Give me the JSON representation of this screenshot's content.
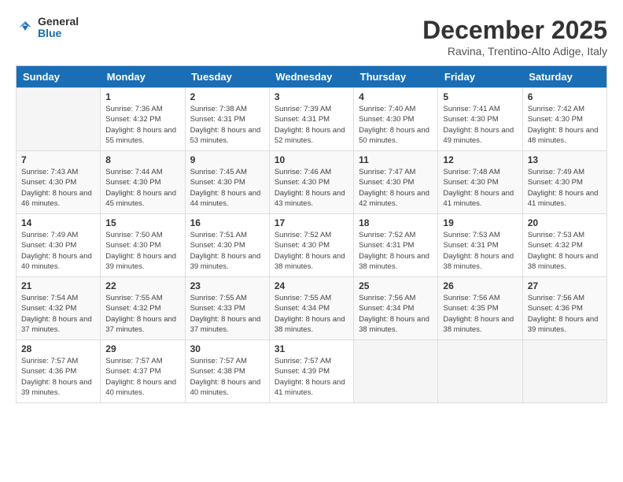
{
  "header": {
    "logo_line1": "General",
    "logo_line2": "Blue",
    "title": "December 2025",
    "subtitle": "Ravina, Trentino-Alto Adige, Italy"
  },
  "weekdays": [
    "Sunday",
    "Monday",
    "Tuesday",
    "Wednesday",
    "Thursday",
    "Friday",
    "Saturday"
  ],
  "weeks": [
    [
      {
        "day": "",
        "sunrise": "",
        "sunset": "",
        "daylight": ""
      },
      {
        "day": "1",
        "sunrise": "Sunrise: 7:36 AM",
        "sunset": "Sunset: 4:32 PM",
        "daylight": "Daylight: 8 hours and 55 minutes."
      },
      {
        "day": "2",
        "sunrise": "Sunrise: 7:38 AM",
        "sunset": "Sunset: 4:31 PM",
        "daylight": "Daylight: 8 hours and 53 minutes."
      },
      {
        "day": "3",
        "sunrise": "Sunrise: 7:39 AM",
        "sunset": "Sunset: 4:31 PM",
        "daylight": "Daylight: 8 hours and 52 minutes."
      },
      {
        "day": "4",
        "sunrise": "Sunrise: 7:40 AM",
        "sunset": "Sunset: 4:30 PM",
        "daylight": "Daylight: 8 hours and 50 minutes."
      },
      {
        "day": "5",
        "sunrise": "Sunrise: 7:41 AM",
        "sunset": "Sunset: 4:30 PM",
        "daylight": "Daylight: 8 hours and 49 minutes."
      },
      {
        "day": "6",
        "sunrise": "Sunrise: 7:42 AM",
        "sunset": "Sunset: 4:30 PM",
        "daylight": "Daylight: 8 hours and 48 minutes."
      }
    ],
    [
      {
        "day": "7",
        "sunrise": "Sunrise: 7:43 AM",
        "sunset": "Sunset: 4:30 PM",
        "daylight": "Daylight: 8 hours and 46 minutes."
      },
      {
        "day": "8",
        "sunrise": "Sunrise: 7:44 AM",
        "sunset": "Sunset: 4:30 PM",
        "daylight": "Daylight: 8 hours and 45 minutes."
      },
      {
        "day": "9",
        "sunrise": "Sunrise: 7:45 AM",
        "sunset": "Sunset: 4:30 PM",
        "daylight": "Daylight: 8 hours and 44 minutes."
      },
      {
        "day": "10",
        "sunrise": "Sunrise: 7:46 AM",
        "sunset": "Sunset: 4:30 PM",
        "daylight": "Daylight: 8 hours and 43 minutes."
      },
      {
        "day": "11",
        "sunrise": "Sunrise: 7:47 AM",
        "sunset": "Sunset: 4:30 PM",
        "daylight": "Daylight: 8 hours and 42 minutes."
      },
      {
        "day": "12",
        "sunrise": "Sunrise: 7:48 AM",
        "sunset": "Sunset: 4:30 PM",
        "daylight": "Daylight: 8 hours and 41 minutes."
      },
      {
        "day": "13",
        "sunrise": "Sunrise: 7:49 AM",
        "sunset": "Sunset: 4:30 PM",
        "daylight": "Daylight: 8 hours and 41 minutes."
      }
    ],
    [
      {
        "day": "14",
        "sunrise": "Sunrise: 7:49 AM",
        "sunset": "Sunset: 4:30 PM",
        "daylight": "Daylight: 8 hours and 40 minutes."
      },
      {
        "day": "15",
        "sunrise": "Sunrise: 7:50 AM",
        "sunset": "Sunset: 4:30 PM",
        "daylight": "Daylight: 8 hours and 39 minutes."
      },
      {
        "day": "16",
        "sunrise": "Sunrise: 7:51 AM",
        "sunset": "Sunset: 4:30 PM",
        "daylight": "Daylight: 8 hours and 39 minutes."
      },
      {
        "day": "17",
        "sunrise": "Sunrise: 7:52 AM",
        "sunset": "Sunset: 4:30 PM",
        "daylight": "Daylight: 8 hours and 38 minutes."
      },
      {
        "day": "18",
        "sunrise": "Sunrise: 7:52 AM",
        "sunset": "Sunset: 4:31 PM",
        "daylight": "Daylight: 8 hours and 38 minutes."
      },
      {
        "day": "19",
        "sunrise": "Sunrise: 7:53 AM",
        "sunset": "Sunset: 4:31 PM",
        "daylight": "Daylight: 8 hours and 38 minutes."
      },
      {
        "day": "20",
        "sunrise": "Sunrise: 7:53 AM",
        "sunset": "Sunset: 4:32 PM",
        "daylight": "Daylight: 8 hours and 38 minutes."
      }
    ],
    [
      {
        "day": "21",
        "sunrise": "Sunrise: 7:54 AM",
        "sunset": "Sunset: 4:32 PM",
        "daylight": "Daylight: 8 hours and 37 minutes."
      },
      {
        "day": "22",
        "sunrise": "Sunrise: 7:55 AM",
        "sunset": "Sunset: 4:32 PM",
        "daylight": "Daylight: 8 hours and 37 minutes."
      },
      {
        "day": "23",
        "sunrise": "Sunrise: 7:55 AM",
        "sunset": "Sunset: 4:33 PM",
        "daylight": "Daylight: 8 hours and 37 minutes."
      },
      {
        "day": "24",
        "sunrise": "Sunrise: 7:55 AM",
        "sunset": "Sunset: 4:34 PM",
        "daylight": "Daylight: 8 hours and 38 minutes."
      },
      {
        "day": "25",
        "sunrise": "Sunrise: 7:56 AM",
        "sunset": "Sunset: 4:34 PM",
        "daylight": "Daylight: 8 hours and 38 minutes."
      },
      {
        "day": "26",
        "sunrise": "Sunrise: 7:56 AM",
        "sunset": "Sunset: 4:35 PM",
        "daylight": "Daylight: 8 hours and 38 minutes."
      },
      {
        "day": "27",
        "sunrise": "Sunrise: 7:56 AM",
        "sunset": "Sunset: 4:36 PM",
        "daylight": "Daylight: 8 hours and 39 minutes."
      }
    ],
    [
      {
        "day": "28",
        "sunrise": "Sunrise: 7:57 AM",
        "sunset": "Sunset: 4:36 PM",
        "daylight": "Daylight: 8 hours and 39 minutes."
      },
      {
        "day": "29",
        "sunrise": "Sunrise: 7:57 AM",
        "sunset": "Sunset: 4:37 PM",
        "daylight": "Daylight: 8 hours and 40 minutes."
      },
      {
        "day": "30",
        "sunrise": "Sunrise: 7:57 AM",
        "sunset": "Sunset: 4:38 PM",
        "daylight": "Daylight: 8 hours and 40 minutes."
      },
      {
        "day": "31",
        "sunrise": "Sunrise: 7:57 AM",
        "sunset": "Sunset: 4:39 PM",
        "daylight": "Daylight: 8 hours and 41 minutes."
      },
      {
        "day": "",
        "sunrise": "",
        "sunset": "",
        "daylight": ""
      },
      {
        "day": "",
        "sunrise": "",
        "sunset": "",
        "daylight": ""
      },
      {
        "day": "",
        "sunrise": "",
        "sunset": "",
        "daylight": ""
      }
    ]
  ]
}
